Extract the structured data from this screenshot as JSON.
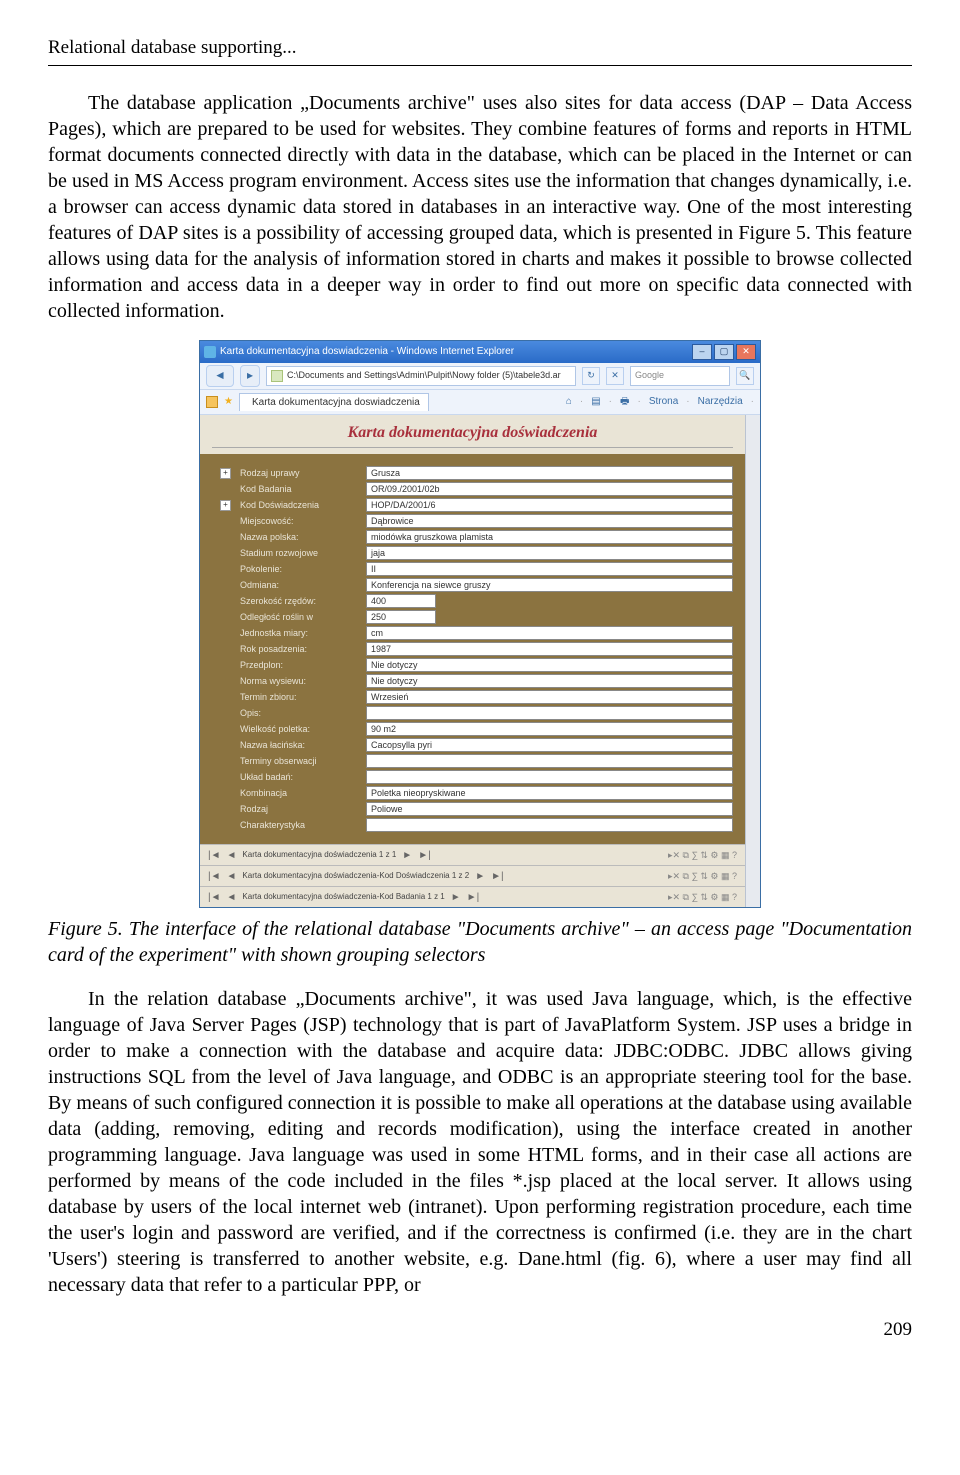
{
  "header": {
    "running_title": "Relational database supporting..."
  },
  "paragraph1": "The database application „Documents archive\" uses also sites for data access (DAP – Data Access Pages), which are prepared to be used for websites. They combine features of forms and reports in HTML format documents connected directly with data in the database, which can be placed in the Internet or can be used in MS Access program environment. Access sites use the information that changes dynamically, i.e. a browser can access dynamic data stored in databases in an interactive way. One of the most interesting features of DAP sites is a possibility of accessing grouped data, which is presented in Figure 5. This feature allows using data for the analysis of information stored in charts and makes it possible to browse collected information and access data in a deeper way in order to find out more on specific data connected with collected information.",
  "caption": "Figure 5. The interface of the relational database \"Documents archive\" – an access page \"Documentation card of the experiment\" with shown grouping selectors",
  "paragraph2": "In the relation database „Documents archive\", it was used Java language, which, is the effective language of Java Server Pages (JSP) technology that is part of JavaPlatform System. JSP uses a bridge in order to make a connection with the database and acquire data: JDBC:ODBC. JDBC allows giving instructions SQL from the level of Java language, and ODBC is an appropriate steering tool for the base. By means of such configured connection it is possible to make all operations at the database using available data (adding, removing, editing and records modification), using the interface created in another programming language. Java language was used in some HTML forms, and in their case all actions are performed by means of the code included in the files *.jsp placed at the local server. It allows using database by users of the local internet web (intranet). Upon performing registration procedure, each time the user's login and password are verified, and if the correctness is confirmed (i.e. they are in the chart 'Users') steering is transferred to another website, e.g. Dane.html (fig. 6), where a user may find all necessary data that refer to a particular PPP, or",
  "ie": {
    "title": "Karta dokumentacyjna doswiadczenia - Windows Internet Explorer",
    "address": "C:\\Documents and Settings\\Admin\\Pulpit\\Nowy folder (5)\\tabele3d.ar",
    "search_placeholder": "Google",
    "tab": "Karta dokumentacyjna doswiadczenia",
    "tb2_home": "Strona",
    "tb2_tools": "Narzędzia",
    "content_title": "Karta dokumentacyjna doświadczenia"
  },
  "form": [
    {
      "exp": true,
      "label": "Rodzaj uprawy",
      "value": "Grusza"
    },
    {
      "exp": false,
      "label": "Kod Badania",
      "value": "OR/09./2001/02b"
    },
    {
      "exp": true,
      "label": "Kod Doświadczenia",
      "value": "HOP/DA/2001/6"
    },
    {
      "exp": false,
      "label": "Miejscowość:",
      "value": "Dąbrowice"
    },
    {
      "exp": false,
      "label": "Nazwa polska:",
      "value": "miodówka gruszkowa plamista"
    },
    {
      "exp": false,
      "label": "Stadium rozwojowe",
      "value": "jaja"
    },
    {
      "exp": false,
      "label": "Pokolenie:",
      "value": "II"
    },
    {
      "exp": false,
      "label": "Odmiana:",
      "value": "Konferencja na siewce gruszy"
    },
    {
      "exp": false,
      "label": "Szerokość rzędów:",
      "value": "400"
    },
    {
      "exp": false,
      "label": "Odległość roślin w",
      "value": "250"
    },
    {
      "exp": false,
      "label": "Jednostka miary:",
      "value": "cm"
    },
    {
      "exp": false,
      "label": "Rok posadzenia:",
      "value": "1987"
    },
    {
      "exp": false,
      "label": "Przedplon:",
      "value": "Nie dotyczy"
    },
    {
      "exp": false,
      "label": "Norma wysiewu:",
      "value": "Nie dotyczy"
    },
    {
      "exp": false,
      "label": "Termin zbioru:",
      "value": "Wrzesień"
    },
    {
      "exp": false,
      "label": "Opis:",
      "value": ""
    },
    {
      "exp": false,
      "label": "Wielkość poletka:",
      "value": "90 m2"
    },
    {
      "exp": false,
      "label": "Nazwa łacińska:",
      "value": "Cacopsylla pyri"
    },
    {
      "exp": false,
      "label": "Terminy obserwacji",
      "value": ""
    },
    {
      "exp": false,
      "label": "Układ badań:",
      "value": ""
    },
    {
      "exp": false,
      "label": "Kombinacja",
      "value": "Poletka nieopryskiwane"
    },
    {
      "exp": false,
      "label": "Rodzaj",
      "value": "Poliowe"
    },
    {
      "exp": false,
      "label": "Charakterystyka",
      "value": ""
    }
  ],
  "navlines": [
    "Karta dokumentacyjna doświadczenia 1 z 1",
    "Karta dokumentacyjna doświadczenia-Kod Doświadczenia 1 z 2",
    "Karta dokumentacyjna doświadczenia-Kod Badania 1 z 1"
  ],
  "page_number": "209"
}
